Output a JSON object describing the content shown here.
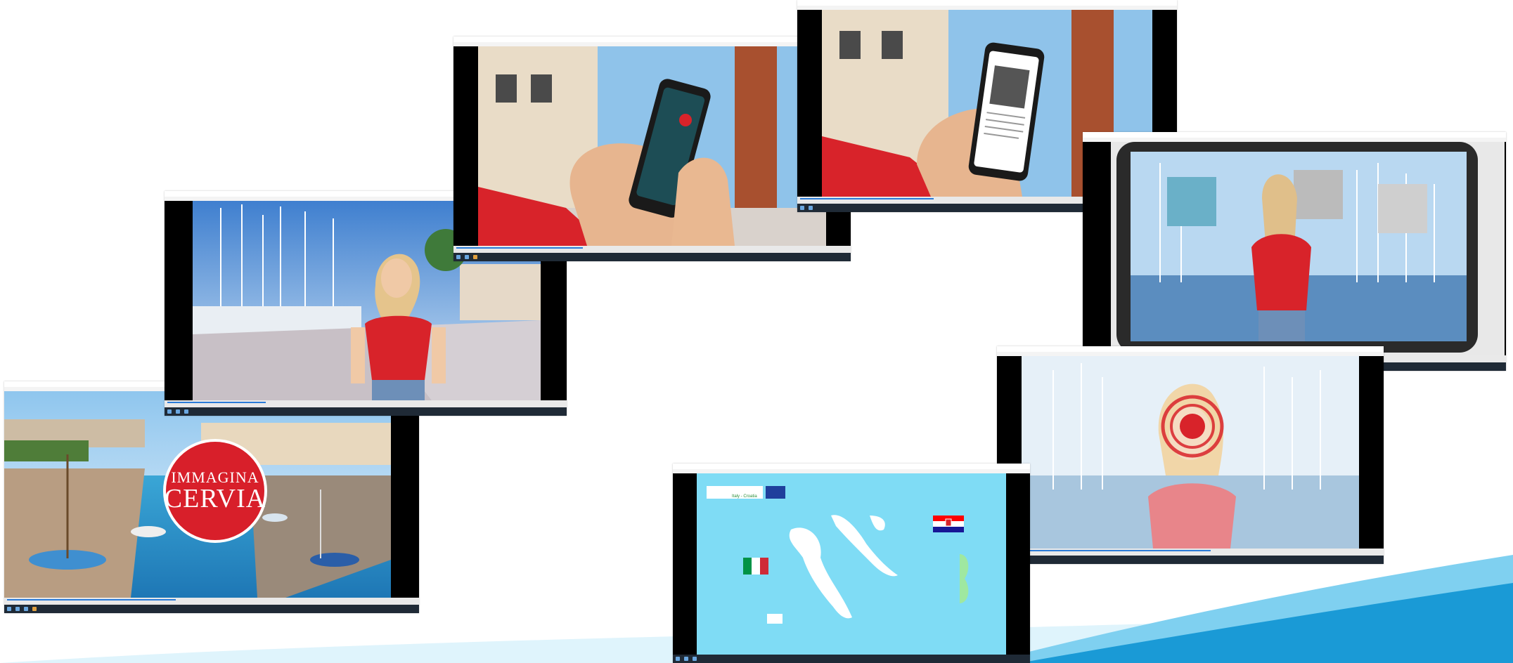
{
  "colors": {
    "accent_blue": "#1a9ad6",
    "swoosh_light": "#7fd0f0",
    "red_shirt": "#d8232a",
    "map_bg": "#7fdcf5",
    "taskbar": "#1f2a36"
  },
  "windows": [
    {
      "id": "cervia-logo",
      "title": "",
      "logo_line1": "IMMAGINA",
      "logo_line2": "CERVIA"
    },
    {
      "id": "woman-marina",
      "title": ""
    },
    {
      "id": "phone-call",
      "title": ""
    },
    {
      "id": "phone-article",
      "title": ""
    },
    {
      "id": "tablet-photos",
      "title": ""
    },
    {
      "id": "target-logo",
      "title": ""
    },
    {
      "id": "map-italy-croatia",
      "title": "",
      "program_name": "Italy - Croatia"
    }
  ]
}
